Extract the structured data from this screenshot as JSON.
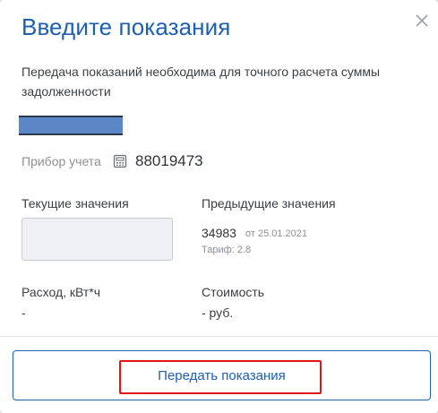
{
  "dialog": {
    "title": "Введите показания",
    "close_icon": "close-icon",
    "description": "Передача показаний необходима для точного расчета суммы задолженности"
  },
  "meter": {
    "label": "Прибор учета",
    "icon": "meter-device-icon",
    "number": "88019473"
  },
  "current": {
    "label": "Текущие значения",
    "value": ""
  },
  "previous": {
    "label": "Предыдущие значения",
    "value": "34983",
    "date": "от 25.01.2021",
    "tariff": "Тариф: 2.8"
  },
  "consumption": {
    "label": "Расход, кВт*ч",
    "value": "-"
  },
  "cost": {
    "label": "Стоимость",
    "value": "- руб."
  },
  "actions": {
    "submit_label": "Передать показания"
  },
  "colors": {
    "accent": "#1f5fae",
    "highlight": "#e2131a",
    "masked_block": "#5b87c7"
  }
}
